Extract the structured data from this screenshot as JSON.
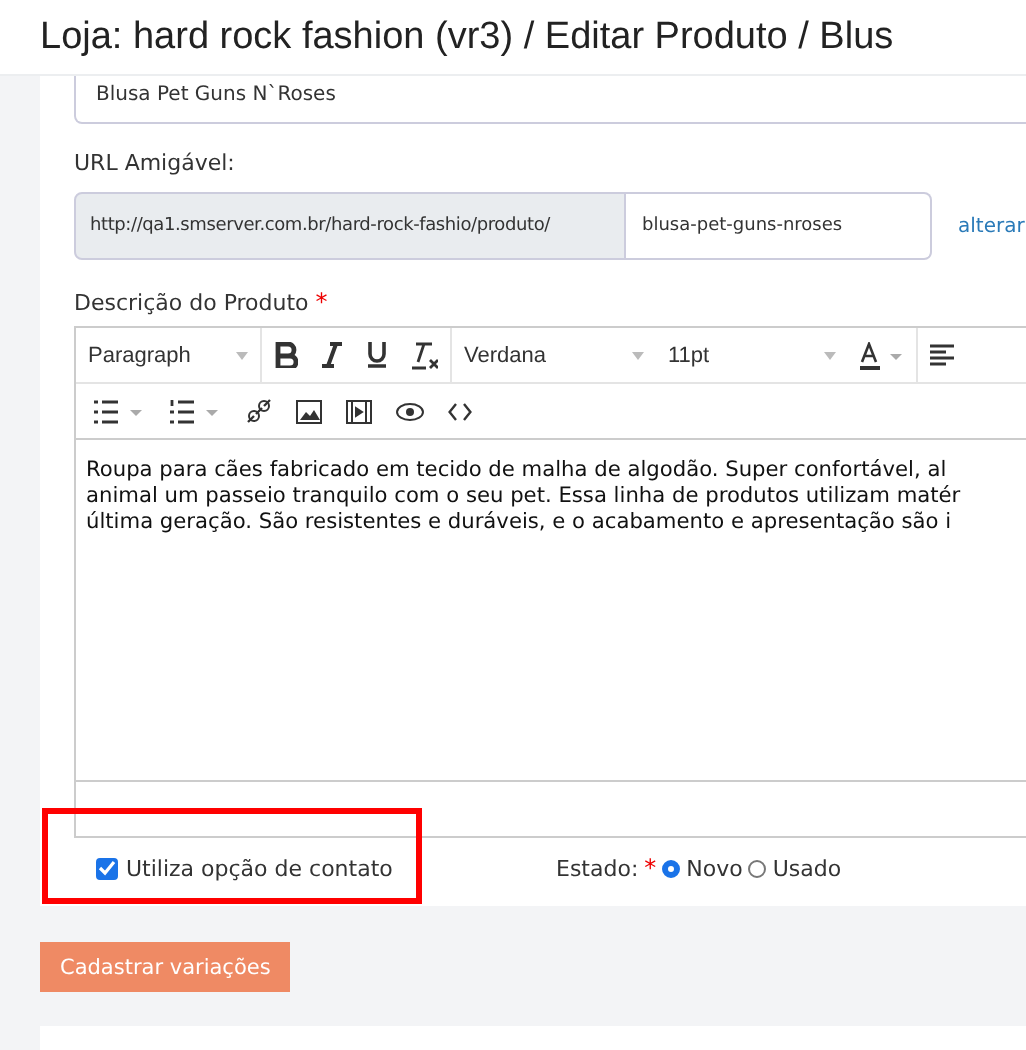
{
  "header": {
    "title": "Loja: hard rock fashion (vr3) / Editar Produto /  Blus"
  },
  "product_name": {
    "value": "Blusa Pet Guns N`Roses"
  },
  "friendly_url": {
    "label": "URL Amigável:",
    "prefix": "http://qa1.smserver.com.br/hard-rock-fashio/produto/",
    "value": "blusa-pet-guns-nroses",
    "link": "alterar"
  },
  "description": {
    "label": "Descrição do Produto",
    "required_mark": "*",
    "toolbar": {
      "block_format": "Paragraph",
      "font_family": "Verdana",
      "font_size": "11pt"
    },
    "lines": [
      "Roupa para cães fabricado em tecido de malha de algodão. Super confortável, al",
      "animal um passeio tranquilo com o seu pet. Essa linha de produtos utilizam matér",
      "última geração. São resistentes e duráveis, e o acabamento e apresentação são i"
    ]
  },
  "contact_option": {
    "label": "Utiliza opção de contato",
    "checked": true
  },
  "condition": {
    "label": "Estado:",
    "required_mark": "*",
    "options": [
      {
        "label": "Novo",
        "selected": true
      },
      {
        "label": "Usado",
        "selected": false
      }
    ]
  },
  "variations_button": "Cadastrar variações"
}
